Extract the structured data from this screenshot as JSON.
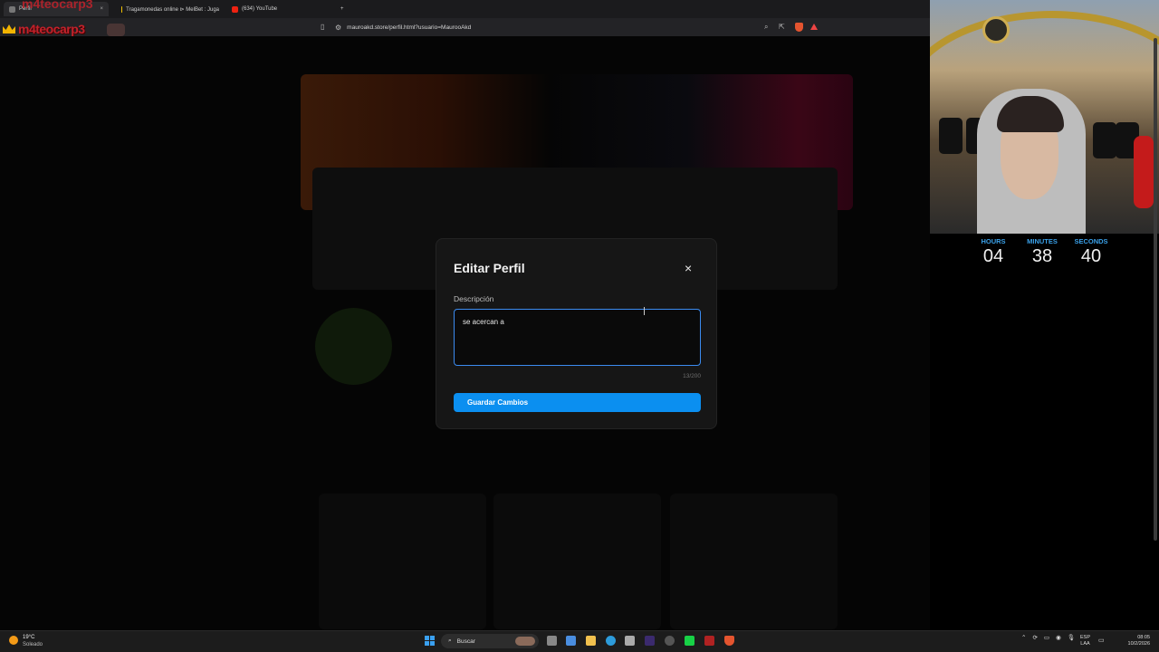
{
  "browser": {
    "tabs": [
      {
        "label": "Perfil",
        "active": true
      },
      {
        "label": "Tragamonedas online ⊳ MelBet : Juga",
        "active": false
      },
      {
        "label": "(634) YouTube",
        "active": false
      }
    ],
    "new_tab": "+",
    "url": "mauroakd.store/perfil.html?usuario=MaurooAkd"
  },
  "overlay": {
    "name": "m4teocarp3"
  },
  "modal": {
    "title": "Editar Perfil",
    "close_label": "×",
    "description_label": "Descripción",
    "description_value": "se acercan a",
    "counter": "13/200",
    "save_label": "Guardar Cambios"
  },
  "timer": {
    "hours_label": "HOURS",
    "minutes_label": "MINUTES",
    "seconds_label": "SECONDS",
    "hours": "04",
    "minutes": "38",
    "seconds": "40"
  },
  "taskbar": {
    "weather_temp": "19°C",
    "weather_desc": "Soleado",
    "search_placeholder": "Buscar",
    "lang_top": "ESP",
    "lang_bottom": "LAA",
    "time": "08:05",
    "date": "10/2/2026"
  },
  "colors": {
    "accent": "#0b8ff0",
    "timer_label": "#3aa0e8",
    "overlay_red": "#c2222b"
  }
}
